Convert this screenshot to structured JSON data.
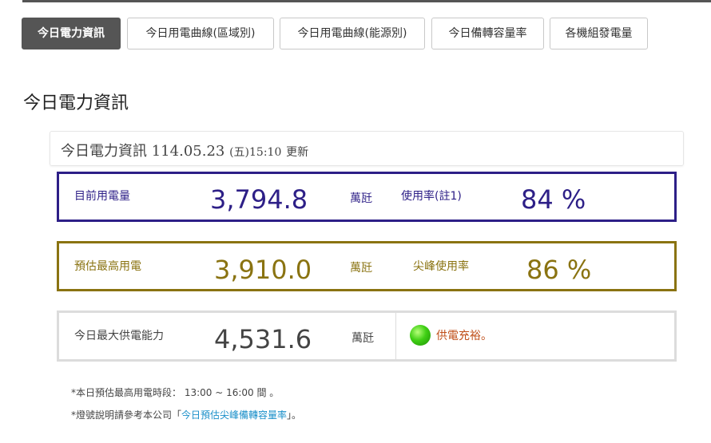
{
  "tabs": [
    {
      "label": "今日電力資訊",
      "active": true
    },
    {
      "label": "今日用電曲線(區域別)",
      "active": false
    },
    {
      "label": "今日用電曲線(能源別)",
      "active": false
    },
    {
      "label": "今日備轉容量率",
      "active": false
    },
    {
      "label": "各機組發電量",
      "active": false
    }
  ],
  "page_title": "今日電力資訊",
  "info_header": {
    "title": "今日電力資訊",
    "date": "114.05.23",
    "weekday": "(五)",
    "time": "15:10",
    "updated_label": "更新"
  },
  "current_load": {
    "label": "目前用電量",
    "value": "3,794.8",
    "unit": "萬瓩",
    "rate_label": "使用率(註1)",
    "rate_value": "84 %",
    "color": "#2d1f87"
  },
  "peak_forecast": {
    "label": "預估最高用電",
    "value": "3,910.0",
    "unit": "萬瓩",
    "rate_label": "尖峰使用率",
    "rate_value": "86 %",
    "color": "#8a7311"
  },
  "max_supply": {
    "label": "今日最大供電能力",
    "value": "4,531.6",
    "unit": "萬瓩",
    "status_text": "供電充裕。",
    "status_light": "green",
    "status_icon": "green-light-icon"
  },
  "notes": {
    "peak_period": "*本日預估最高用電時段： 13:00 ~ 16:00 間 。",
    "light_prefix": "*燈號說明請參考本公司「",
    "light_link": "今日預估尖峰備轉容量率",
    "light_suffix": "」。"
  }
}
